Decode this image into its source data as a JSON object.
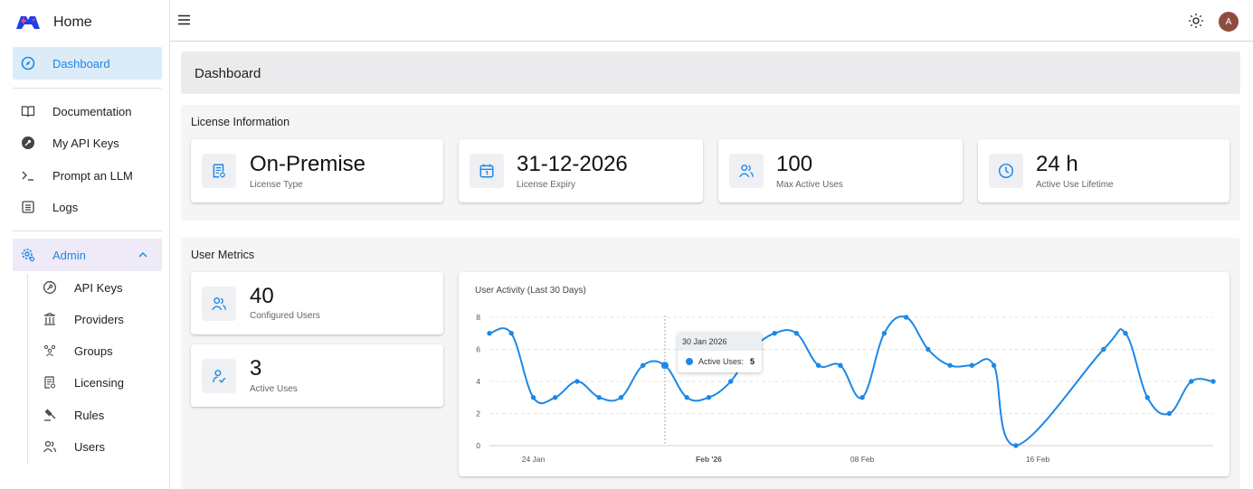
{
  "brand": {
    "title": "Home"
  },
  "sidebar": {
    "items": [
      {
        "label": "Dashboard",
        "icon": "compass-icon"
      },
      {
        "label": "Documentation",
        "icon": "book-icon"
      },
      {
        "label": "My API Keys",
        "icon": "key-icon"
      },
      {
        "label": "Prompt an LLM",
        "icon": "terminal-icon"
      },
      {
        "label": "Logs",
        "icon": "list-icon"
      },
      {
        "label": "Admin",
        "icon": "gear-icon"
      }
    ],
    "admin_items": [
      {
        "label": "API Keys",
        "icon": "key-icon"
      },
      {
        "label": "Providers",
        "icon": "building-icon"
      },
      {
        "label": "Groups",
        "icon": "group-icon"
      },
      {
        "label": "Licensing",
        "icon": "document-icon"
      },
      {
        "label": "Rules",
        "icon": "gavel-icon"
      },
      {
        "label": "Users",
        "icon": "users-icon"
      }
    ]
  },
  "topbar": {
    "avatar_initial": "A"
  },
  "page": {
    "title": "Dashboard"
  },
  "license": {
    "section_title": "License Information",
    "cards": [
      {
        "value": "On-Premise",
        "label": "License Type",
        "icon": "document-icon"
      },
      {
        "value": "31-12-2026",
        "label": "License Expiry",
        "icon": "calendar-icon"
      },
      {
        "value": "100",
        "label": "Max Active Uses",
        "icon": "users-icon"
      },
      {
        "value": "24 h",
        "label": "Active Use Lifetime",
        "icon": "clock-icon"
      }
    ]
  },
  "metrics": {
    "section_title": "User Metrics",
    "cards": [
      {
        "value": "40",
        "label": "Configured Users",
        "icon": "users-icon"
      },
      {
        "value": "3",
        "label": "Active Uses",
        "icon": "user-check-icon"
      }
    ]
  },
  "colors": {
    "accent": "#1e88e5",
    "active_bg": "#dcebf8",
    "admin_bg": "#efeaf7",
    "avatar": "#8d4e3f"
  },
  "chart_data": {
    "type": "line",
    "title": "User Activity (Last 30 Days)",
    "xlabel": "",
    "ylabel": "",
    "ylim": [
      0,
      8
    ],
    "yticks": [
      0,
      2,
      4,
      6,
      8
    ],
    "x_tick_labels": [
      {
        "day": 2,
        "label": "24 Jan"
      },
      {
        "day": 10,
        "label": "Feb '26"
      },
      {
        "day": 17,
        "label": "08 Feb"
      },
      {
        "day": 25,
        "label": "16 Feb"
      }
    ],
    "grid": true,
    "series": [
      {
        "name": "Active Uses",
        "x": [
          "22 Jan",
          "23 Jan",
          "24 Jan",
          "25 Jan",
          "26 Jan",
          "27 Jan",
          "28 Jan",
          "29 Jan",
          "30 Jan",
          "31 Jan",
          "01 Feb",
          "02 Feb",
          "03 Feb",
          "04 Feb",
          "05 Feb",
          "06 Feb",
          "07 Feb",
          "08 Feb",
          "09 Feb",
          "10 Feb",
          "11 Feb",
          "12 Feb",
          "13 Feb",
          "14 Feb",
          "15 Feb",
          "16 Feb",
          "17 Feb",
          "18 Feb",
          "19 Feb",
          "20 Feb",
          "21 Feb",
          "22 Feb",
          "23 Feb",
          "24 Feb"
        ],
        "values": [
          7,
          7,
          3,
          3,
          4,
          3,
          3,
          5,
          5,
          3,
          3,
          4,
          6,
          7,
          7,
          5,
          5,
          3,
          7,
          8,
          6,
          5,
          5,
          5,
          0,
          null,
          null,
          null,
          6,
          7,
          3,
          2,
          4,
          4
        ]
      }
    ],
    "tooltip": {
      "date": "30 Jan 2026",
      "series": "Active Uses:",
      "value": "5"
    }
  }
}
